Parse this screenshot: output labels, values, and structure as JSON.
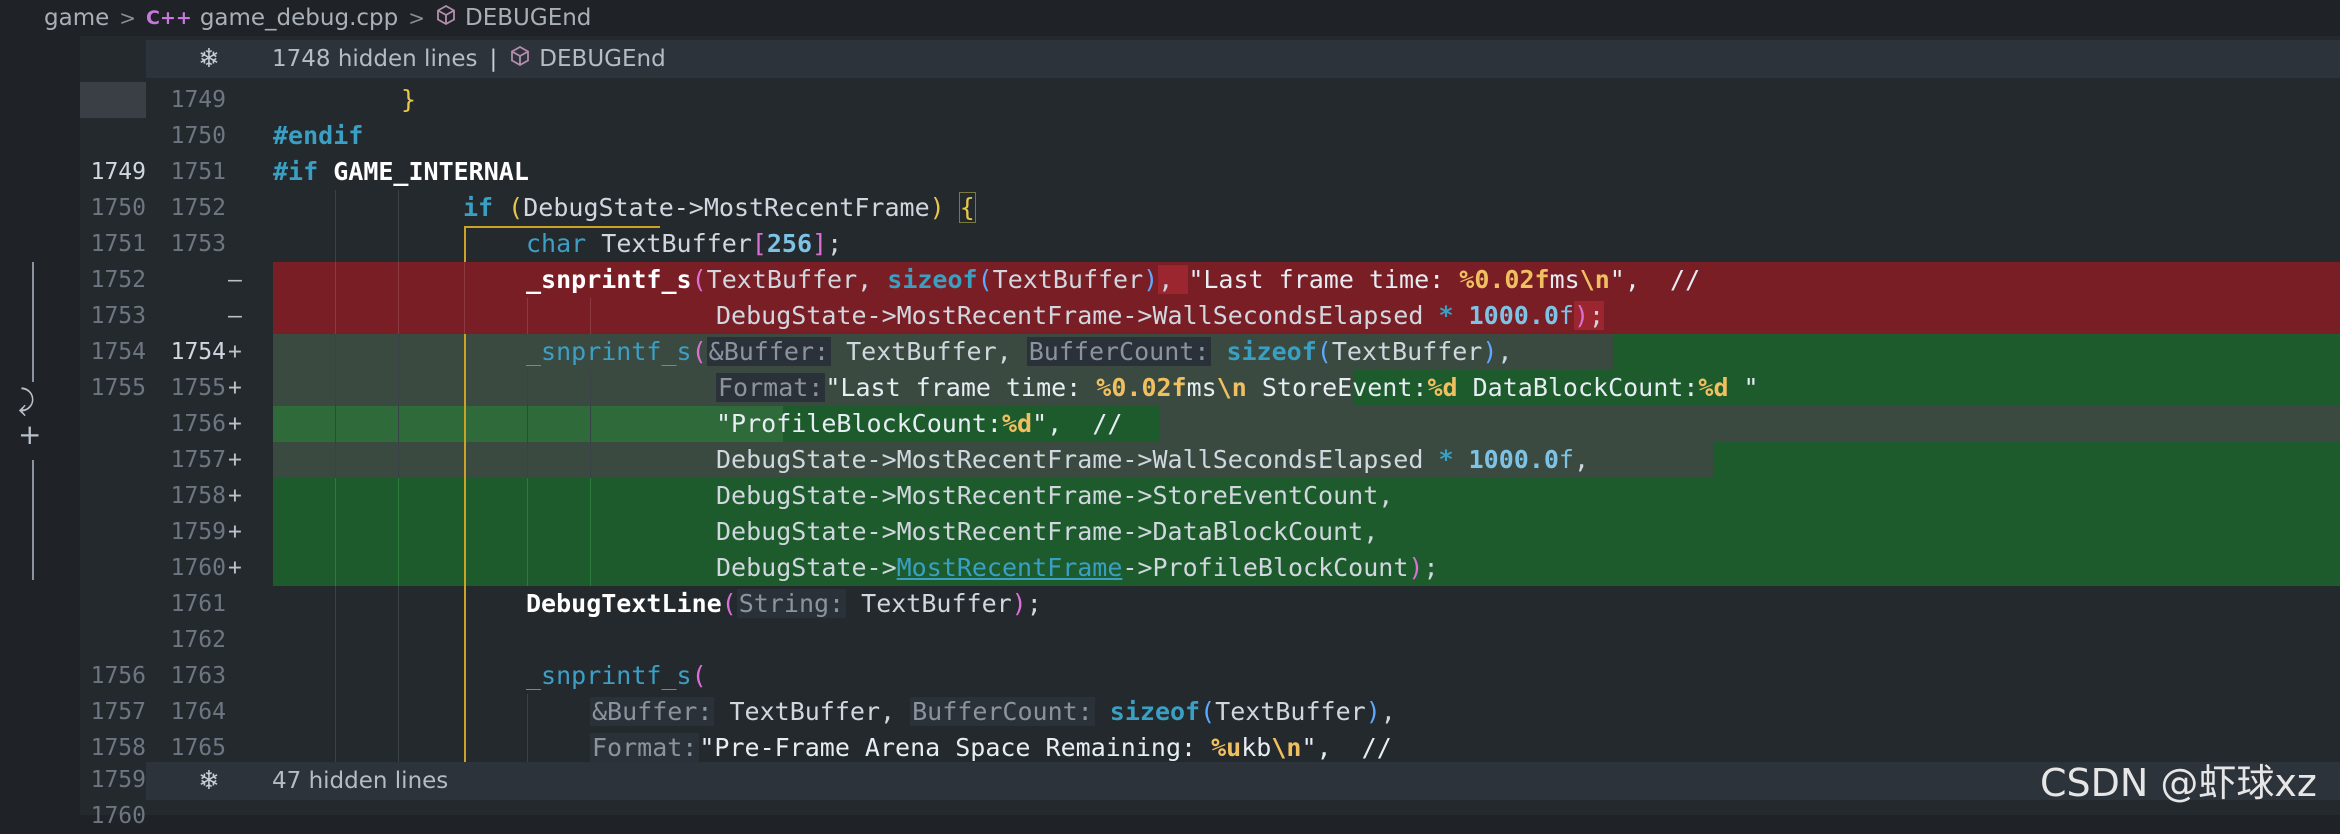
{
  "breadcrumb": {
    "folder": "game",
    "file_lang": "C++",
    "file": "game_debug.cpp",
    "symbol": "DEBUGEnd"
  },
  "fold_top": {
    "hidden": "1748 hidden lines",
    "symbol": "DEBUGEnd"
  },
  "fold_bottom": {
    "hidden": "47 hidden lines"
  },
  "lines": {
    "l0": {
      "orig": "",
      "mod": "1749"
    },
    "l1": {
      "orig": "",
      "mod": "1750"
    },
    "l2": {
      "orig": "1749",
      "mod": "1751"
    },
    "l3": {
      "orig": "1750",
      "mod": "1752"
    },
    "l4": {
      "orig": "1751",
      "mod": "1753"
    },
    "l5": {
      "orig": "1752",
      "mod": "",
      "mark": "—"
    },
    "l6": {
      "orig": "1753",
      "mod": "",
      "mark": "—"
    },
    "l7": {
      "orig": "1754",
      "mod": "1754",
      "mark": "+"
    },
    "l8": {
      "orig": "1755",
      "mod": "1755",
      "mark": "+"
    },
    "l9": {
      "orig": "",
      "mod": "1756",
      "mark": "+"
    },
    "l10": {
      "orig": "",
      "mod": "1757",
      "mark": "+"
    },
    "l11": {
      "orig": "",
      "mod": "1758",
      "mark": "+"
    },
    "l12": {
      "orig": "",
      "mod": "1759",
      "mark": "+"
    },
    "l13": {
      "orig": "",
      "mod": "1760",
      "mark": "+"
    },
    "l14": {
      "orig": "",
      "mod": "1761"
    },
    "l15": {
      "orig": "",
      "mod": "1762"
    },
    "l16": {
      "orig": "1756",
      "mod": "1763"
    },
    "l17": {
      "orig": "1757",
      "mod": "1764"
    },
    "l18": {
      "orig": "1758",
      "mod": "1765"
    },
    "l19": {
      "orig": "1759",
      "mod": ""
    },
    "l20": {
      "orig": "1760",
      "mod": ""
    }
  },
  "code": {
    "brace": "}",
    "endif": "#endif",
    "if_kw": "#if",
    "if_macro": "GAME_INTERNAL",
    "if2": "if",
    "cond": "DebugState->MostRecentFrame",
    "char_kw": "char",
    "buf_decl": "TextBuffer",
    "buf_size": "256",
    "snprintf": "_snprintf_s",
    "textbuffer": "TextBuffer",
    "sizeof": "sizeof",
    "str_last": "\"Last frame time: ",
    "fmt_02": "%0.02f",
    "ms": "ms",
    "nl": "\\n",
    "str_close": "\",",
    "comment": "//",
    "wall": "DebugState->MostRecentFrame->WallSecondsElapsed",
    "mult": "*",
    "num1000": "1000.0",
    "f": "f",
    "hint_buffer": "&Buffer:",
    "hint_bcount": "BufferCount:",
    "hint_format": "Format:",
    "hint_string": "String:",
    "str_storeevent": " StoreEvent:",
    "pct_d": "%d",
    "str_datablock": " DataBlockCount:",
    "str_sp_q": " \"",
    "str_profile": "\"ProfileBlockCount:",
    "q_comma": "\",",
    "store_cnt": "DebugState->MostRecentFrame->StoreEventCount,",
    "datablock_cnt": "DebugState->MostRecentFrame->DataBlockCount,",
    "ds_arrow": "DebugState->",
    "mrf_link": "MostRecentFrame",
    "profile_end": "->ProfileBlockCount",
    "debugtextline": "DebugTextLine",
    "str_preframe": "\"Pre-Frame Arena Space Remaining: ",
    "pct_ukb": "%u",
    "kb": "kb"
  },
  "icons": {
    "unfold": "unfold-icon",
    "symbol": "cube-icon",
    "chevron": "chevron-right-icon",
    "revert": "revert-icon",
    "add": "plus-icon"
  },
  "colors": {
    "deleted": "#7a1e26",
    "added": "#1d5a2c",
    "keyword": "#39a0c4"
  },
  "watermark": "CSDN @虾球xz"
}
